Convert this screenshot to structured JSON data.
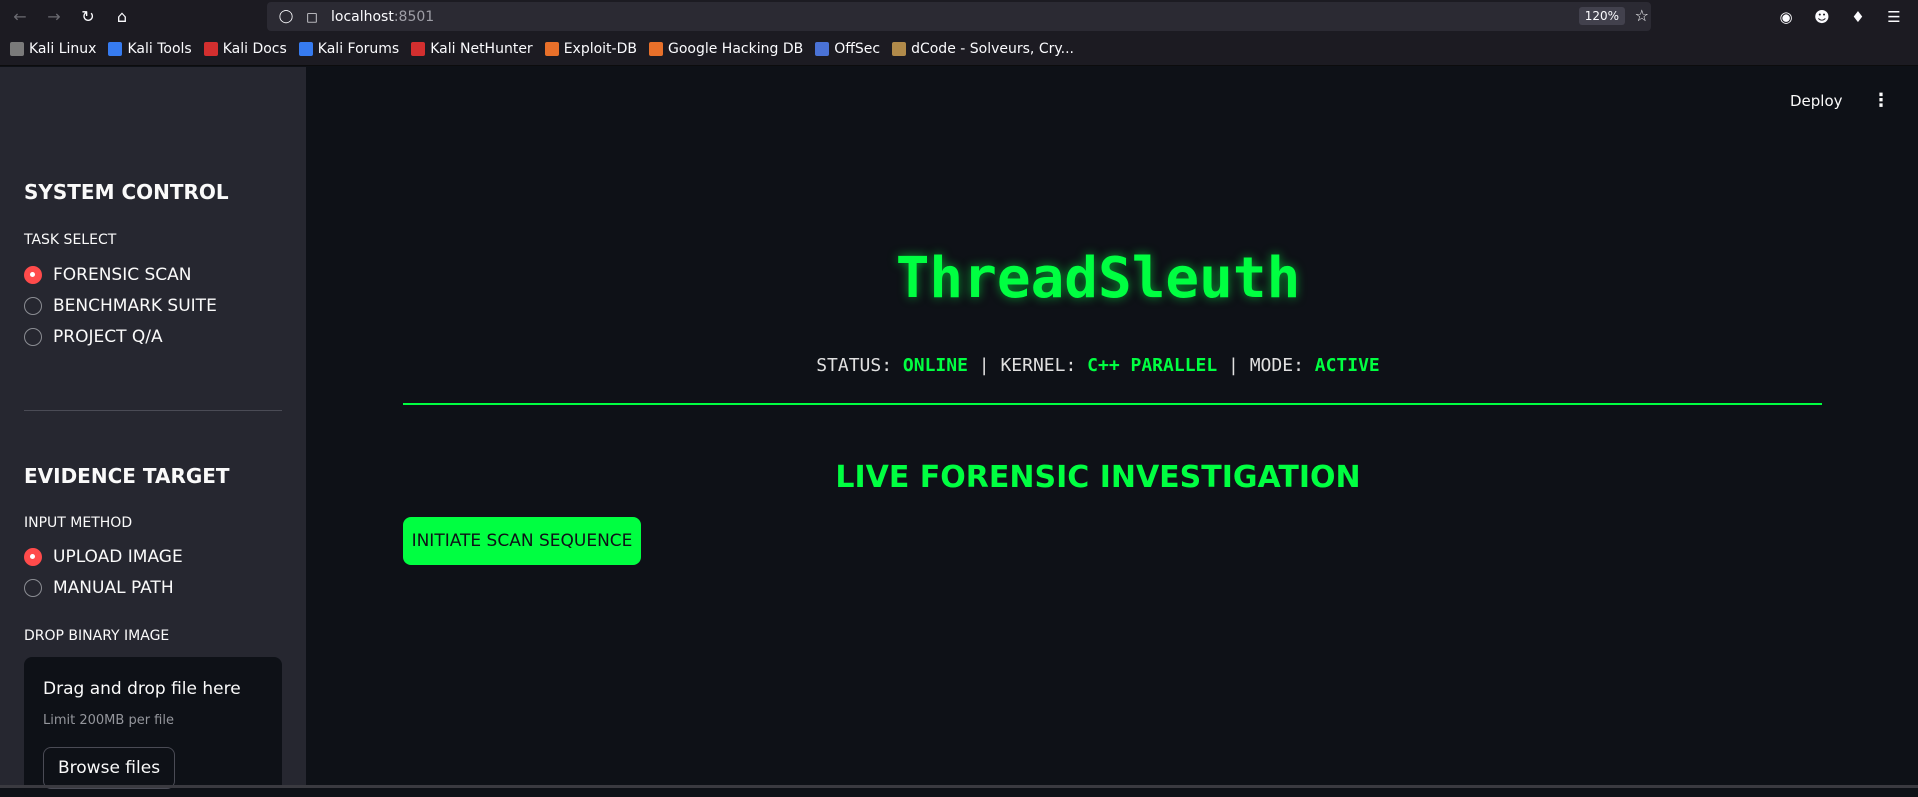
{
  "browser": {
    "url_host": "localhost",
    "url_port": ":8501",
    "zoom": "120%",
    "bookmarks": [
      {
        "label": "Kali Linux",
        "icon": "kali-dragon-icon",
        "color": "#7a7a7a"
      },
      {
        "label": "Kali Tools",
        "icon": "kali-tools-icon",
        "color": "#367bf0"
      },
      {
        "label": "Kali Docs",
        "icon": "kali-docs-icon",
        "color": "#d32f2f"
      },
      {
        "label": "Kali Forums",
        "icon": "kali-forums-icon",
        "color": "#367bf0"
      },
      {
        "label": "Kali NetHunter",
        "icon": "kali-nethunter-icon",
        "color": "#d32f2f"
      },
      {
        "label": "Exploit-DB",
        "icon": "exploit-db-icon",
        "color": "#e8702a"
      },
      {
        "label": "Google Hacking DB",
        "icon": "ghdb-icon",
        "color": "#e8702a"
      },
      {
        "label": "OffSec",
        "icon": "offsec-icon",
        "color": "#4a72d6"
      },
      {
        "label": "dCode - Solveurs, Cry...",
        "icon": "dcode-icon",
        "color": "#b08a4a"
      }
    ]
  },
  "sidebar": {
    "system_title": "SYSTEM CONTROL",
    "task_label": "TASK SELECT",
    "tasks": [
      {
        "label": "FORENSIC SCAN",
        "checked": true
      },
      {
        "label": "BENCHMARK SUITE",
        "checked": false
      },
      {
        "label": "PROJECT Q/A",
        "checked": false
      }
    ],
    "evidence_title": "EVIDENCE TARGET",
    "input_label": "INPUT METHOD",
    "inputs": [
      {
        "label": "UPLOAD IMAGE",
        "checked": true
      },
      {
        "label": "MANUAL PATH",
        "checked": false
      }
    ],
    "drop_label": "DROP BINARY IMAGE",
    "uploader": {
      "title": "Drag and drop file here",
      "limit": "Limit 200MB per file",
      "browse_label": "Browse files"
    }
  },
  "header": {
    "deploy_label": "Deploy"
  },
  "main": {
    "title": "ThreadSleuth",
    "status": {
      "status_key": "STATUS: ",
      "status_val": "ONLINE",
      "sep1": " | ",
      "kernel_key": "KERNEL: ",
      "kernel_val": "C++ PARALLEL",
      "sep2": " | ",
      "mode_key": "MODE: ",
      "mode_val": "ACTIVE"
    },
    "section_heading": "LIVE FORENSIC INVESTIGATION",
    "scan_button": "INITIATE SCAN SEQUENCE"
  },
  "colors": {
    "accent_green": "#00ff41",
    "radio_red": "#ff4b4b",
    "background": "#0e1117",
    "sidebar_bg": "#262730"
  }
}
